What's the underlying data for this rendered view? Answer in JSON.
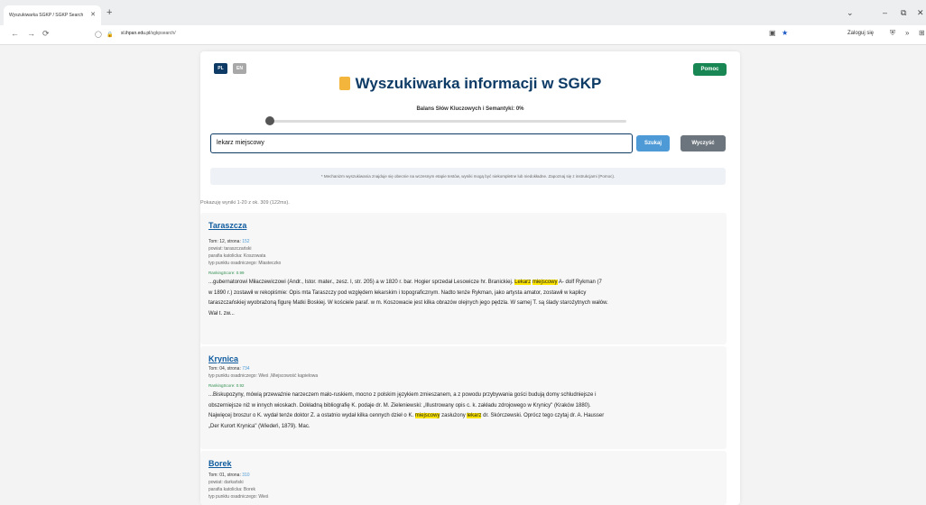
{
  "browser": {
    "tab_title": "Wyszukiwarka SGKP / SGKP Search",
    "tab_close": "✕",
    "new_tab": "+",
    "url_host": "sl.ihpan.edu.pl",
    "url_path": "/sgkpsearch/",
    "login_label": "Zaloguj się",
    "back": "←",
    "forward": "→",
    "reload": "⟳",
    "minimize": "–",
    "restore": "⧉",
    "close": "✕",
    "expand": "⌄",
    "star": "★",
    "reader": "▣",
    "extensions": "⊞",
    "more": "»",
    "shield": "⛨",
    "lock": "🔒",
    "page_icon": "◯"
  },
  "page": {
    "lang_pl": "PL",
    "lang_en": "EN",
    "help_label": "Pomoc",
    "title": "Wyszukiwarka informacji w SGKP",
    "slider_label": "Balans Słów Kluczowych i Semantyki: 0%",
    "slider_value": 0,
    "search_value": "lekarz miejscowy",
    "search_button": "Szukaj",
    "clear_button": "Wyczyść",
    "notice": "* Mechanizm wyszukiwania znajduje się obecnie na wczesnym etapie testów, wyniki mogą być niekompletne lub niedokładne. Zapoznaj się z instrukcjami (Pomoc).",
    "results_count": "Pokazuję wyniki 1-20 z ok. 309 (122ms).",
    "colors": {
      "primary": "#0d3b66",
      "success": "#198754",
      "accent": "#4d9ad6",
      "highlight": "#ffe600"
    }
  },
  "results": [
    {
      "title": "Taraszcza",
      "tom_label": "Tom: 12, strona:",
      "tom_page": "152",
      "meta": [
        "powiat: taraszczański",
        "parafia katolicka: Koszowata",
        "typ punktu osadniczego: Miasteczko"
      ],
      "ranking": "RankingScore: 0.99",
      "snippet_lines": [
        [
          "...gubernatorowi Miłaczewiczowi (Andr., Istor. mater., zesz. I, str. 205) a w 1820 r. bar. Hogier sprzedał Lesowicze hr. Branickiej. ",
          "Lekarz",
          " ",
          "miejscowy",
          " A- dolf Rykman (7"
        ],
        [
          "w 1890 r.) zostawił w rekopiśmie: Opis mta Taraszczy pod względem lekarskim i topograficznym. Nadto tenże Rykman, jako artysta amator, zostawił w kaplicy"
        ],
        [
          "taraszczańskiej wyobrażoną figurę Matki Boskiej. W kościele paraf. w m. Koszowacie jest kilka obrazów olejnych jego pędzla. W samej T. są ślady starożytnych wałów."
        ],
        [
          "Wał t. zw..."
        ]
      ]
    },
    {
      "title": "Krynica",
      "tom_label": "Tom: 04, strona:",
      "tom_page": "734",
      "meta": [
        "typ punktu osadniczego: Wieś ,Miejscowość kąpielowa"
      ],
      "ranking": "RankingScore: 0.92",
      "snippet_lines": [
        [
          "...Biskupozyny, mówią przeważnie narzeczem malo-ruskiem, mocno z polskim językiem zmieszanem, a z powodu przybywania gości budują domy schludniejsze i"
        ],
        [
          "obszerniejsze niż w innych wioskach. Dokładną bibliografię K. podaje dr. M. Zieleniewski: „Illustrowany opis c. k. zakładu zdrojowego w Krynicy\" (Kraków 1880)."
        ],
        [
          "Najwięcej broszur o K. wydał tenże doktor Z. a ostatnio wydał kilka cennych dzieł o K. ",
          "miejscowy",
          " zasłużony ",
          "lekarz",
          " dr. Skórczewski. Oprócz tego czytaj dr. A. Hausser"
        ],
        [
          "„Der Kurort Krynica\" (Wiedeń, 1879). Mac."
        ]
      ]
    },
    {
      "title": "Borek",
      "tom_label": "Tom: 01, strona:",
      "tom_page": "310",
      "meta": [
        "powiat: darkański",
        "parafia katolicka: Borek",
        "typ punktu osadniczego: Wieś"
      ],
      "ranking": "",
      "snippet_lines": []
    }
  ]
}
